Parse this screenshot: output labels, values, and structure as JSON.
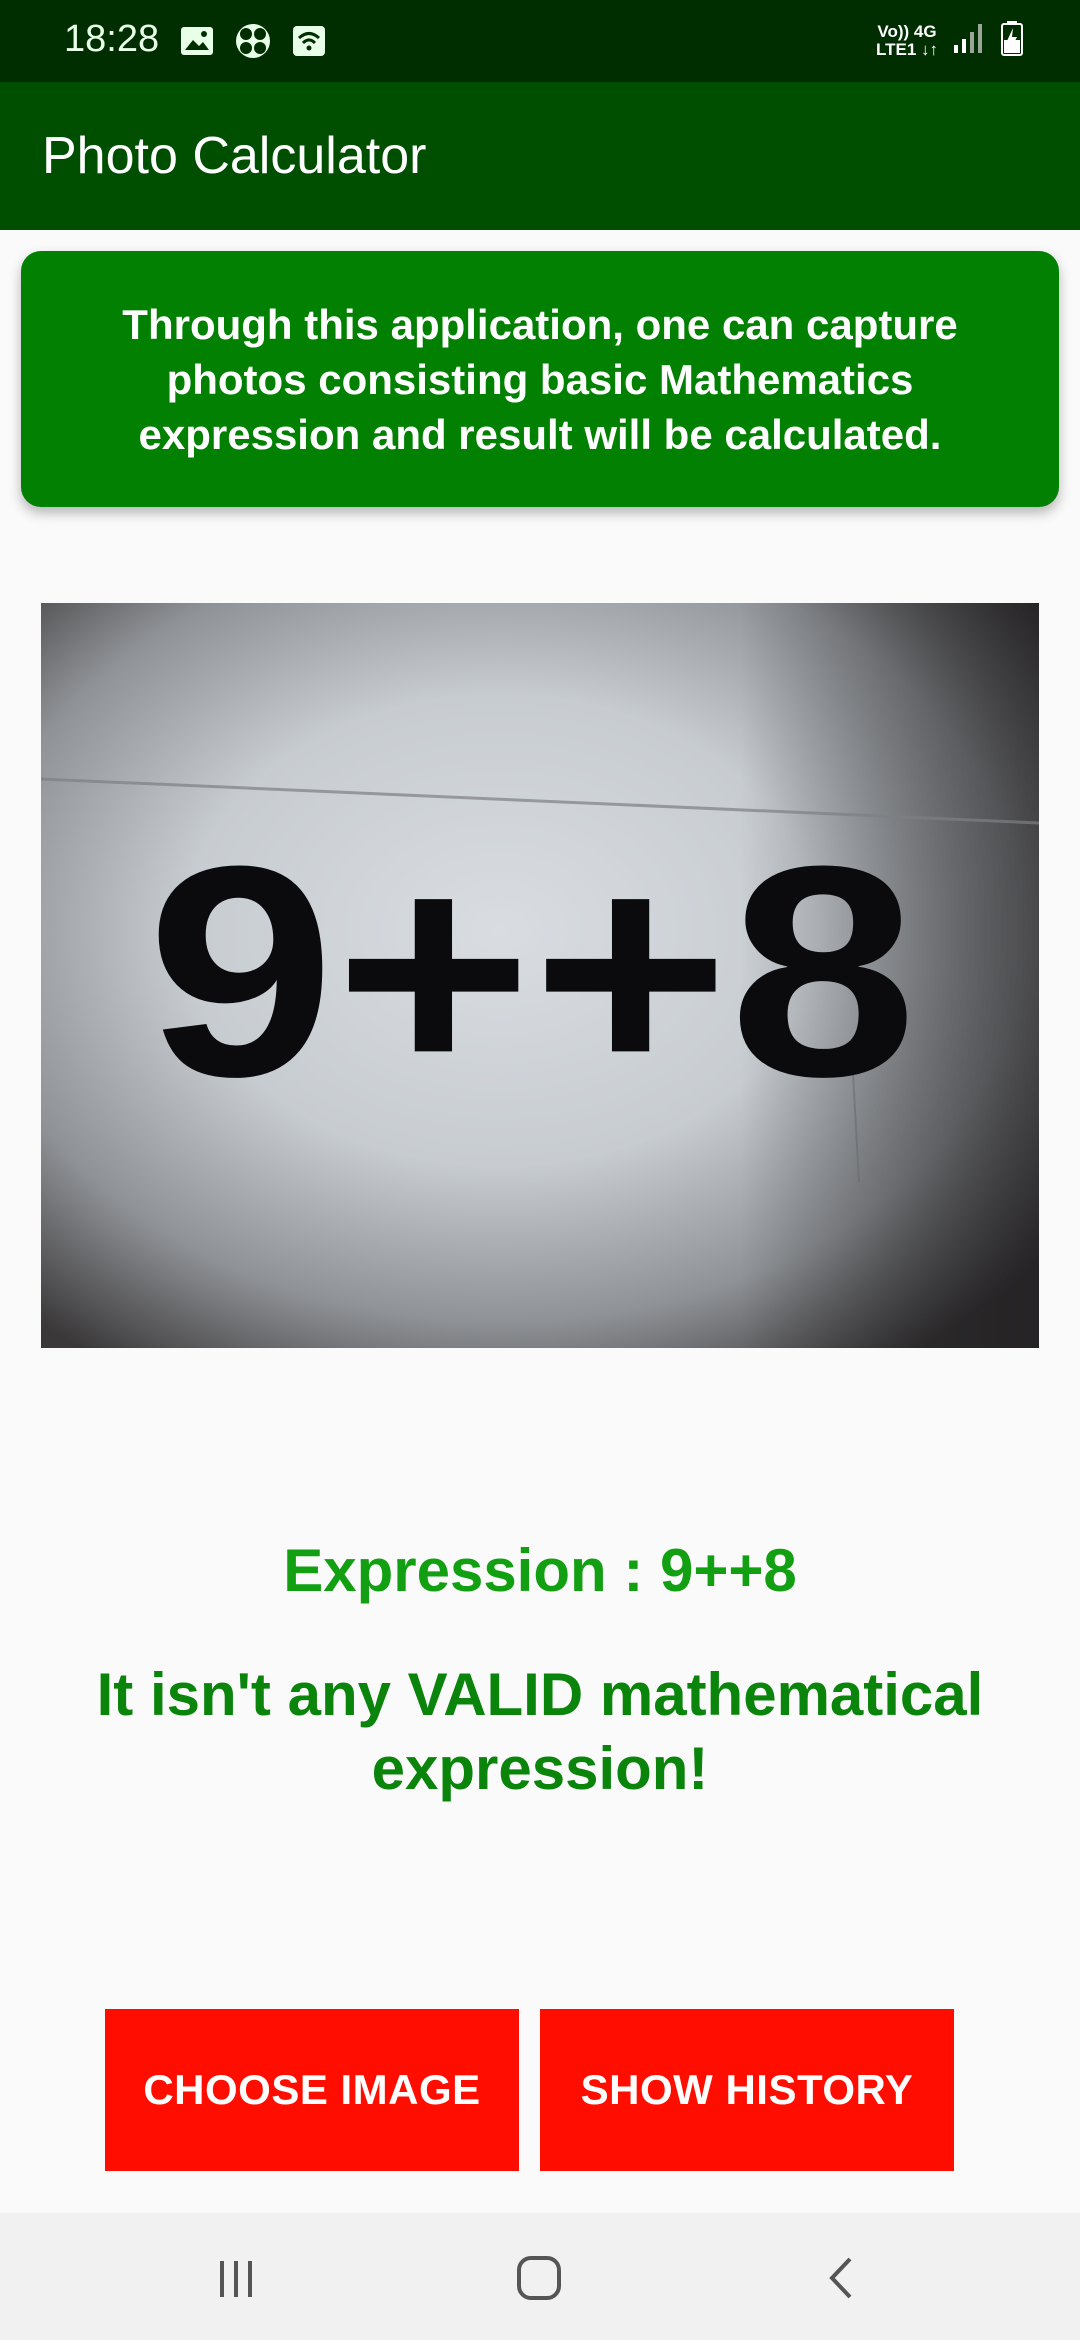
{
  "status_bar": {
    "time": "18:28",
    "icons_left": [
      "image-icon",
      "fan-icon",
      "wifi-icon"
    ],
    "network_label_top": "Vo)) 4G",
    "network_label_bottom": "LTE1 ↓↑",
    "icons_right": [
      "signal-icon",
      "battery-charging-icon"
    ]
  },
  "app_bar": {
    "title": "Photo Calculator",
    "color": "#004f00"
  },
  "info_card": {
    "text": "Through this application, one can capture photos consisting basic Mathematics expression and result will be calculated.",
    "color": "#028002"
  },
  "photo": {
    "depicted_text": "9++8"
  },
  "expression_text": "Expression : 9++8",
  "result_text": "It isn't any VALID mathematical expression!",
  "buttons": {
    "choose_image": "CHOOSE IMAGE",
    "show_history": "SHOW HISTORY",
    "color": "#ff0e00"
  },
  "nav_bar": {
    "items": [
      "recent-apps-icon",
      "home-icon",
      "back-icon"
    ]
  }
}
